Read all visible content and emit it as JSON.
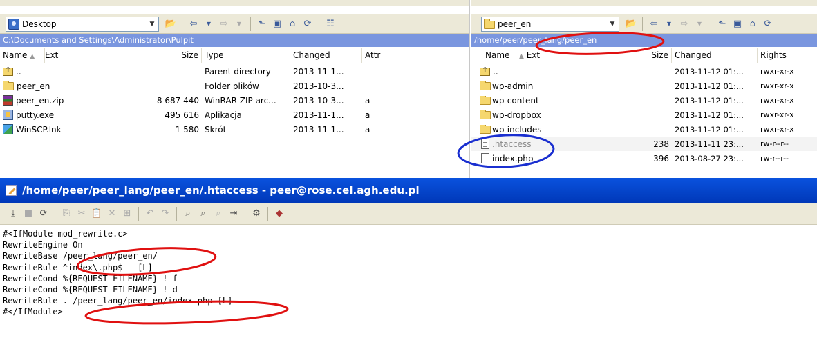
{
  "left": {
    "location": "Desktop",
    "path": "C:\\Documents and Settings\\Administrator\\Pulpit",
    "columns": {
      "name": "Name",
      "ext": "Ext",
      "size": "Size",
      "type": "Type",
      "changed": "Changed",
      "attr": "Attr"
    },
    "rows": [
      {
        "icon": "updir-icon",
        "name": "..",
        "size": "",
        "type": "Parent directory",
        "changed": "2013-11-1...",
        "attr": ""
      },
      {
        "icon": "folder-icon",
        "name": "peer_en",
        "size": "",
        "type": "Folder plików",
        "changed": "2013-10-3...",
        "attr": ""
      },
      {
        "icon": "winrar-icon",
        "name": "peer_en.zip",
        "size": "8 687 440",
        "type": "WinRAR ZIP arc...",
        "changed": "2013-10-3...",
        "attr": "a"
      },
      {
        "icon": "putty-icon",
        "name": "putty.exe",
        "size": "495 616",
        "type": "Aplikacja",
        "changed": "2013-11-1...",
        "attr": "a"
      },
      {
        "icon": "shortcut-icon",
        "name": "WinSCP.lnk",
        "size": "1 580",
        "type": "Skrót",
        "changed": "2013-11-1...",
        "attr": "a"
      }
    ]
  },
  "right": {
    "location": "peer_en",
    "path": "/home/peer/peer_lang/peer_en",
    "columns": {
      "name": "Name",
      "ext": "Ext",
      "size": "Size",
      "changed": "Changed",
      "rights": "Rights"
    },
    "rows": [
      {
        "icon": "updir-icon",
        "name": "..",
        "size": "",
        "changed": "2013-11-12 01:...",
        "rights": "rwxr-xr-x"
      },
      {
        "icon": "folder-icon",
        "name": "wp-admin",
        "size": "",
        "changed": "2013-11-12 01:...",
        "rights": "rwxr-xr-x"
      },
      {
        "icon": "folder-icon",
        "name": "wp-content",
        "size": "",
        "changed": "2013-11-12 01:...",
        "rights": "rwxr-xr-x"
      },
      {
        "icon": "folder-icon",
        "name": "wp-dropbox",
        "size": "",
        "changed": "2013-11-12 01:...",
        "rights": "rwxr-xr-x"
      },
      {
        "icon": "folder-icon",
        "name": "wp-includes",
        "size": "",
        "changed": "2013-11-12 01:...",
        "rights": "rwxr-xr-x"
      },
      {
        "icon": "file-icon",
        "name": ".htaccess",
        "size": "238",
        "changed": "2013-11-11 23:...",
        "rights": "rw-r--r--"
      },
      {
        "icon": "file-icon",
        "name": "index.php",
        "size": "396",
        "changed": "2013-08-27 23:...",
        "rights": "rw-r--r--"
      }
    ]
  },
  "editor": {
    "title": "/home/peer/peer_lang/peer_en/.htaccess - peer@rose.cel.agh.edu.pl",
    "lines": [
      "#<IfModule mod_rewrite.c>",
      "RewriteEngine On",
      "RewriteBase /peer_lang/peer_en/",
      "RewriteRule ^index\\.php$ - [L]",
      "RewriteCond %{REQUEST_FILENAME} !-f",
      "RewriteCond %{REQUEST_FILENAME} !-d",
      "RewriteRule . /peer_lang/peer_en/index.php [L]",
      "#</IfModule>"
    ]
  },
  "colors": {
    "path_bar": "#7a96df",
    "title_bar": "#0a52de",
    "annotation_red": "#e01010",
    "annotation_blue": "#1a2fd0"
  }
}
